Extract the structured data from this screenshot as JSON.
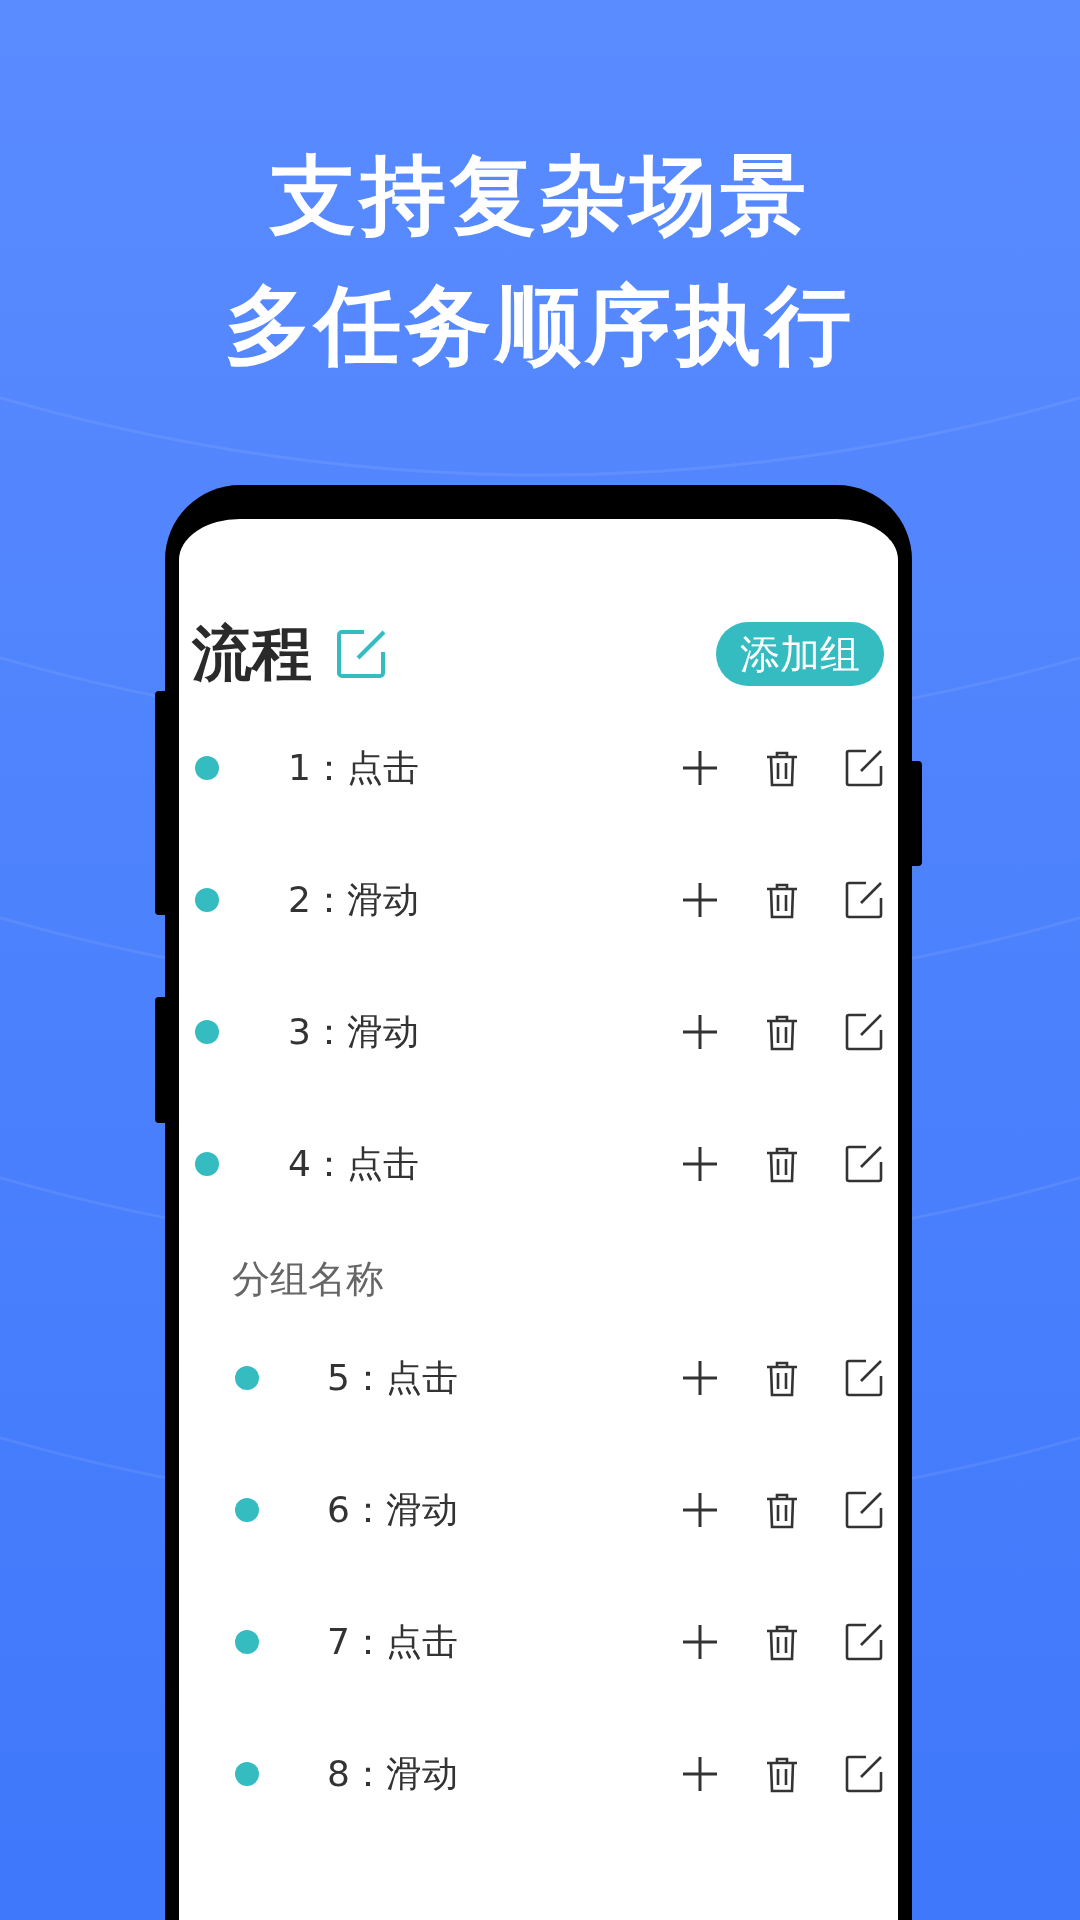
{
  "headline": [
    "支持复杂场景",
    "多任务顺序执行"
  ],
  "title": "流程",
  "add_button": "添加组",
  "steps": [
    {
      "label": "1：点击"
    },
    {
      "label": "2：滑动"
    },
    {
      "label": "3：滑动"
    },
    {
      "label": "4：点击"
    }
  ],
  "groups": [
    {
      "name": "分组名称",
      "steps": [
        {
          "label": "5：点击"
        },
        {
          "label": "6：滑动"
        },
        {
          "label": "7：点击"
        },
        {
          "label": "8：滑动"
        }
      ]
    }
  ]
}
